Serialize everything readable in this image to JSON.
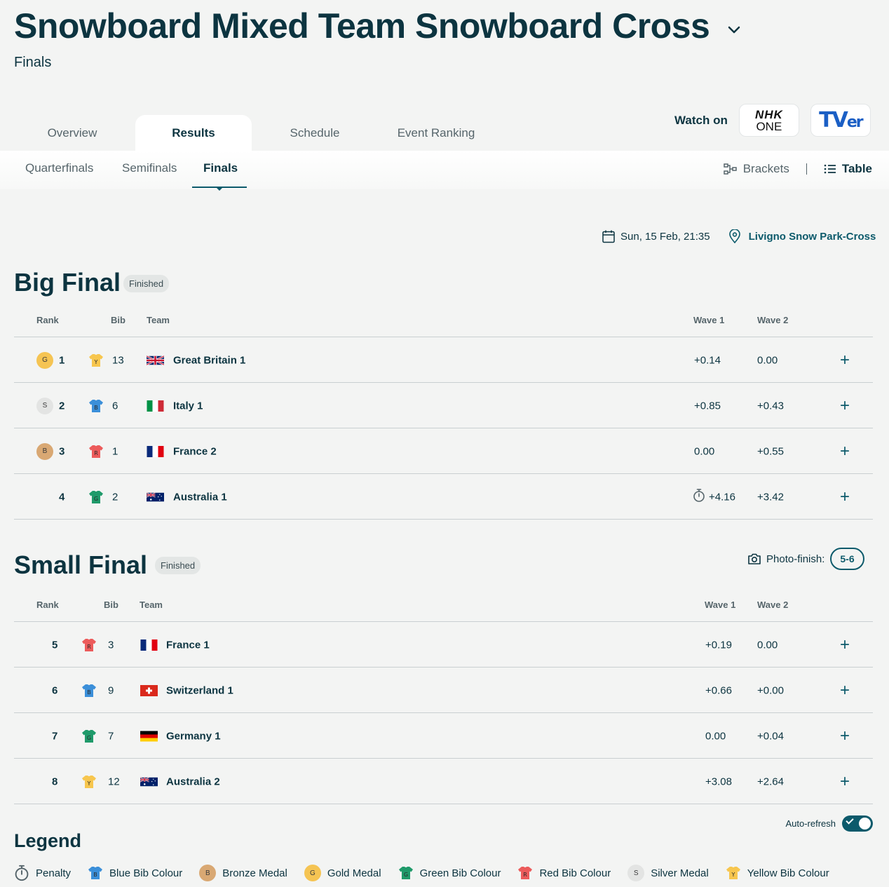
{
  "header": {
    "title": "Snowboard Mixed Team Snowboard Cross",
    "subtitle": "Finals"
  },
  "main_tabs": [
    {
      "label": "Overview"
    },
    {
      "label": "Results",
      "active": true
    },
    {
      "label": "Schedule"
    },
    {
      "label": "Event Ranking"
    }
  ],
  "watch": {
    "label": "Watch on",
    "nhk_line1": "NHK",
    "nhk_line2": "ONE",
    "tver_big": "TV",
    "tver_small": "er"
  },
  "sub_tabs": [
    {
      "label": "Quarterfinals"
    },
    {
      "label": "Semifinals"
    },
    {
      "label": "Finals",
      "active": true
    }
  ],
  "view_toggle": {
    "brackets": "Brackets",
    "table": "Table",
    "selected": "Table"
  },
  "meta": {
    "datetime": "Sun, 15 Feb, 21:35",
    "venue": "Livigno Snow Park-Cross"
  },
  "columns": {
    "rank": "Rank",
    "bib": "Bib",
    "team": "Team",
    "wave1": "Wave 1",
    "wave2": "Wave 2"
  },
  "big_final": {
    "title": "Big Final",
    "status": "Finished",
    "rows": [
      {
        "medal": "G",
        "rank": "1",
        "bib_colour": "Y",
        "bib": "13",
        "country": "gbr",
        "team": "Great Britain 1",
        "wave1": "+0.14",
        "wave2": "0.00",
        "penalty": false
      },
      {
        "medal": "S",
        "rank": "2",
        "bib_colour": "B",
        "bib": "6",
        "country": "ita",
        "team": "Italy 1",
        "wave1": "+0.85",
        "wave2": "+0.43",
        "penalty": false
      },
      {
        "medal": "B",
        "rank": "3",
        "bib_colour": "R",
        "bib": "1",
        "country": "fra",
        "team": "France 2",
        "wave1": "0.00",
        "wave2": "+0.55",
        "penalty": false
      },
      {
        "medal": "",
        "rank": "4",
        "bib_colour": "G",
        "bib": "2",
        "country": "aus",
        "team": "Australia 1",
        "wave1": "+4.16",
        "wave2": "+3.42",
        "penalty": true
      }
    ]
  },
  "small_final": {
    "title": "Small Final",
    "status": "Finished",
    "photo_finish_label": "Photo-finish:",
    "photo_finish_value": "5-6",
    "rows": [
      {
        "rank": "5",
        "bib_colour": "R",
        "bib": "3",
        "country": "fra",
        "team": "France 1",
        "wave1": "+0.19",
        "wave2": "0.00"
      },
      {
        "rank": "6",
        "bib_colour": "B",
        "bib": "9",
        "country": "sui",
        "team": "Switzerland 1",
        "wave1": "+0.66",
        "wave2": "+0.00"
      },
      {
        "rank": "7",
        "bib_colour": "G",
        "bib": "7",
        "country": "ger",
        "team": "Germany 1",
        "wave1": "0.00",
        "wave2": "+0.04"
      },
      {
        "rank": "8",
        "bib_colour": "Y",
        "bib": "12",
        "country": "aus",
        "team": "Australia 2",
        "wave1": "+3.08",
        "wave2": "+2.64"
      }
    ]
  },
  "autorefresh": {
    "label": "Auto-refresh",
    "on": true
  },
  "legend": {
    "title": "Legend",
    "items": [
      {
        "icon": "stopwatch-icon",
        "label": "Penalty"
      },
      {
        "icon": "blue-bib-icon",
        "code": "B",
        "label": "Blue Bib Colour"
      },
      {
        "icon": "bronze-medal-icon",
        "code": "B",
        "label": "Bronze Medal"
      },
      {
        "icon": "gold-medal-icon",
        "code": "G",
        "label": "Gold Medal"
      },
      {
        "icon": "green-bib-icon",
        "code": "G",
        "label": "Green Bib Colour"
      },
      {
        "icon": "red-bib-icon",
        "code": "R",
        "label": "Red Bib Colour"
      },
      {
        "icon": "silver-medal-icon",
        "code": "S",
        "label": "Silver Medal"
      },
      {
        "icon": "yellow-bib-icon",
        "code": "Y",
        "label": "Yellow Bib Colour"
      }
    ]
  },
  "colors": {
    "brand_dark": "#0c3440",
    "accent": "#0c5a6b",
    "gold": "#f5c453",
    "silver": "#e3e4e3",
    "bronze": "#d9a873",
    "bib_yellow": "#f7c64e",
    "bib_blue": "#3b8fd9",
    "bib_red": "#ec5b5b",
    "bib_green": "#1f9a6a"
  }
}
